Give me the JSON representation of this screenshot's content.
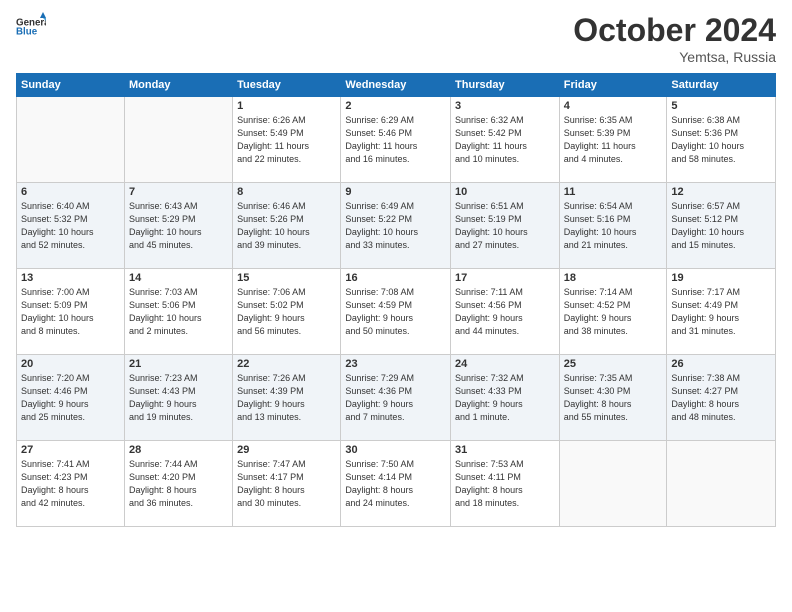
{
  "header": {
    "logo_general": "General",
    "logo_blue": "Blue",
    "month_title": "October 2024",
    "location": "Yemtsa, Russia"
  },
  "days_of_week": [
    "Sunday",
    "Monday",
    "Tuesday",
    "Wednesday",
    "Thursday",
    "Friday",
    "Saturday"
  ],
  "weeks": [
    [
      {
        "day": "",
        "detail": ""
      },
      {
        "day": "",
        "detail": ""
      },
      {
        "day": "1",
        "detail": "Sunrise: 6:26 AM\nSunset: 5:49 PM\nDaylight: 11 hours\nand 22 minutes."
      },
      {
        "day": "2",
        "detail": "Sunrise: 6:29 AM\nSunset: 5:46 PM\nDaylight: 11 hours\nand 16 minutes."
      },
      {
        "day": "3",
        "detail": "Sunrise: 6:32 AM\nSunset: 5:42 PM\nDaylight: 11 hours\nand 10 minutes."
      },
      {
        "day": "4",
        "detail": "Sunrise: 6:35 AM\nSunset: 5:39 PM\nDaylight: 11 hours\nand 4 minutes."
      },
      {
        "day": "5",
        "detail": "Sunrise: 6:38 AM\nSunset: 5:36 PM\nDaylight: 10 hours\nand 58 minutes."
      }
    ],
    [
      {
        "day": "6",
        "detail": "Sunrise: 6:40 AM\nSunset: 5:32 PM\nDaylight: 10 hours\nand 52 minutes."
      },
      {
        "day": "7",
        "detail": "Sunrise: 6:43 AM\nSunset: 5:29 PM\nDaylight: 10 hours\nand 45 minutes."
      },
      {
        "day": "8",
        "detail": "Sunrise: 6:46 AM\nSunset: 5:26 PM\nDaylight: 10 hours\nand 39 minutes."
      },
      {
        "day": "9",
        "detail": "Sunrise: 6:49 AM\nSunset: 5:22 PM\nDaylight: 10 hours\nand 33 minutes."
      },
      {
        "day": "10",
        "detail": "Sunrise: 6:51 AM\nSunset: 5:19 PM\nDaylight: 10 hours\nand 27 minutes."
      },
      {
        "day": "11",
        "detail": "Sunrise: 6:54 AM\nSunset: 5:16 PM\nDaylight: 10 hours\nand 21 minutes."
      },
      {
        "day": "12",
        "detail": "Sunrise: 6:57 AM\nSunset: 5:12 PM\nDaylight: 10 hours\nand 15 minutes."
      }
    ],
    [
      {
        "day": "13",
        "detail": "Sunrise: 7:00 AM\nSunset: 5:09 PM\nDaylight: 10 hours\nand 8 minutes."
      },
      {
        "day": "14",
        "detail": "Sunrise: 7:03 AM\nSunset: 5:06 PM\nDaylight: 10 hours\nand 2 minutes."
      },
      {
        "day": "15",
        "detail": "Sunrise: 7:06 AM\nSunset: 5:02 PM\nDaylight: 9 hours\nand 56 minutes."
      },
      {
        "day": "16",
        "detail": "Sunrise: 7:08 AM\nSunset: 4:59 PM\nDaylight: 9 hours\nand 50 minutes."
      },
      {
        "day": "17",
        "detail": "Sunrise: 7:11 AM\nSunset: 4:56 PM\nDaylight: 9 hours\nand 44 minutes."
      },
      {
        "day": "18",
        "detail": "Sunrise: 7:14 AM\nSunset: 4:52 PM\nDaylight: 9 hours\nand 38 minutes."
      },
      {
        "day": "19",
        "detail": "Sunrise: 7:17 AM\nSunset: 4:49 PM\nDaylight: 9 hours\nand 31 minutes."
      }
    ],
    [
      {
        "day": "20",
        "detail": "Sunrise: 7:20 AM\nSunset: 4:46 PM\nDaylight: 9 hours\nand 25 minutes."
      },
      {
        "day": "21",
        "detail": "Sunrise: 7:23 AM\nSunset: 4:43 PM\nDaylight: 9 hours\nand 19 minutes."
      },
      {
        "day": "22",
        "detail": "Sunrise: 7:26 AM\nSunset: 4:39 PM\nDaylight: 9 hours\nand 13 minutes."
      },
      {
        "day": "23",
        "detail": "Sunrise: 7:29 AM\nSunset: 4:36 PM\nDaylight: 9 hours\nand 7 minutes."
      },
      {
        "day": "24",
        "detail": "Sunrise: 7:32 AM\nSunset: 4:33 PM\nDaylight: 9 hours\nand 1 minute."
      },
      {
        "day": "25",
        "detail": "Sunrise: 7:35 AM\nSunset: 4:30 PM\nDaylight: 8 hours\nand 55 minutes."
      },
      {
        "day": "26",
        "detail": "Sunrise: 7:38 AM\nSunset: 4:27 PM\nDaylight: 8 hours\nand 48 minutes."
      }
    ],
    [
      {
        "day": "27",
        "detail": "Sunrise: 7:41 AM\nSunset: 4:23 PM\nDaylight: 8 hours\nand 42 minutes."
      },
      {
        "day": "28",
        "detail": "Sunrise: 7:44 AM\nSunset: 4:20 PM\nDaylight: 8 hours\nand 36 minutes."
      },
      {
        "day": "29",
        "detail": "Sunrise: 7:47 AM\nSunset: 4:17 PM\nDaylight: 8 hours\nand 30 minutes."
      },
      {
        "day": "30",
        "detail": "Sunrise: 7:50 AM\nSunset: 4:14 PM\nDaylight: 8 hours\nand 24 minutes."
      },
      {
        "day": "31",
        "detail": "Sunrise: 7:53 AM\nSunset: 4:11 PM\nDaylight: 8 hours\nand 18 minutes."
      },
      {
        "day": "",
        "detail": ""
      },
      {
        "day": "",
        "detail": ""
      }
    ]
  ]
}
